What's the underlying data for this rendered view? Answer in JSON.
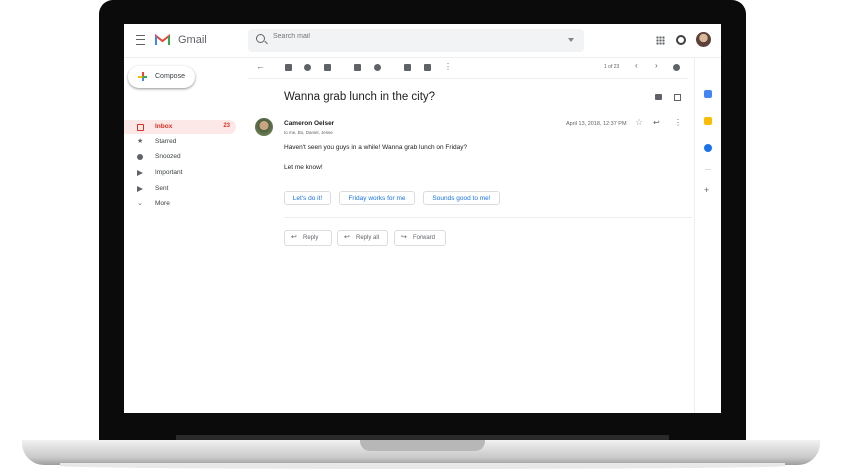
{
  "app": {
    "name": "Gmail"
  },
  "search": {
    "placeholder": "Search mail"
  },
  "compose": {
    "label": "Compose"
  },
  "sidebar": {
    "items": [
      {
        "label": "Inbox",
        "count": "23",
        "icon": "inbox-icon",
        "active": true
      },
      {
        "label": "Starred",
        "icon": "star-icon"
      },
      {
        "label": "Snoozed",
        "icon": "clock-icon"
      },
      {
        "label": "Important",
        "icon": "important-icon"
      },
      {
        "label": "Sent",
        "icon": "send-icon"
      },
      {
        "label": "More",
        "icon": "chevron-down-icon"
      }
    ]
  },
  "toolbar": {
    "pager": "1 of 23"
  },
  "email": {
    "subject": "Wanna grab lunch in the city?",
    "sender": "Cameron Oelser",
    "recipients": "to me, Bo, Daniel, Jesse",
    "date": "April 13, 2018, 12:37 PM",
    "body": [
      "Haven't seen you guys in a while! Wanna grab lunch on Friday?",
      "Let me know!"
    ]
  },
  "smart_replies": [
    "Let's do it!",
    "Friday works for me",
    "Sounds good to me!"
  ],
  "actions": {
    "reply": "Reply",
    "reply_all": "Reply all",
    "forward": "Forward"
  },
  "colors": {
    "accent": "#1a73e8",
    "inbox_active": "#d93025",
    "active_bg": "#fce8e6"
  }
}
